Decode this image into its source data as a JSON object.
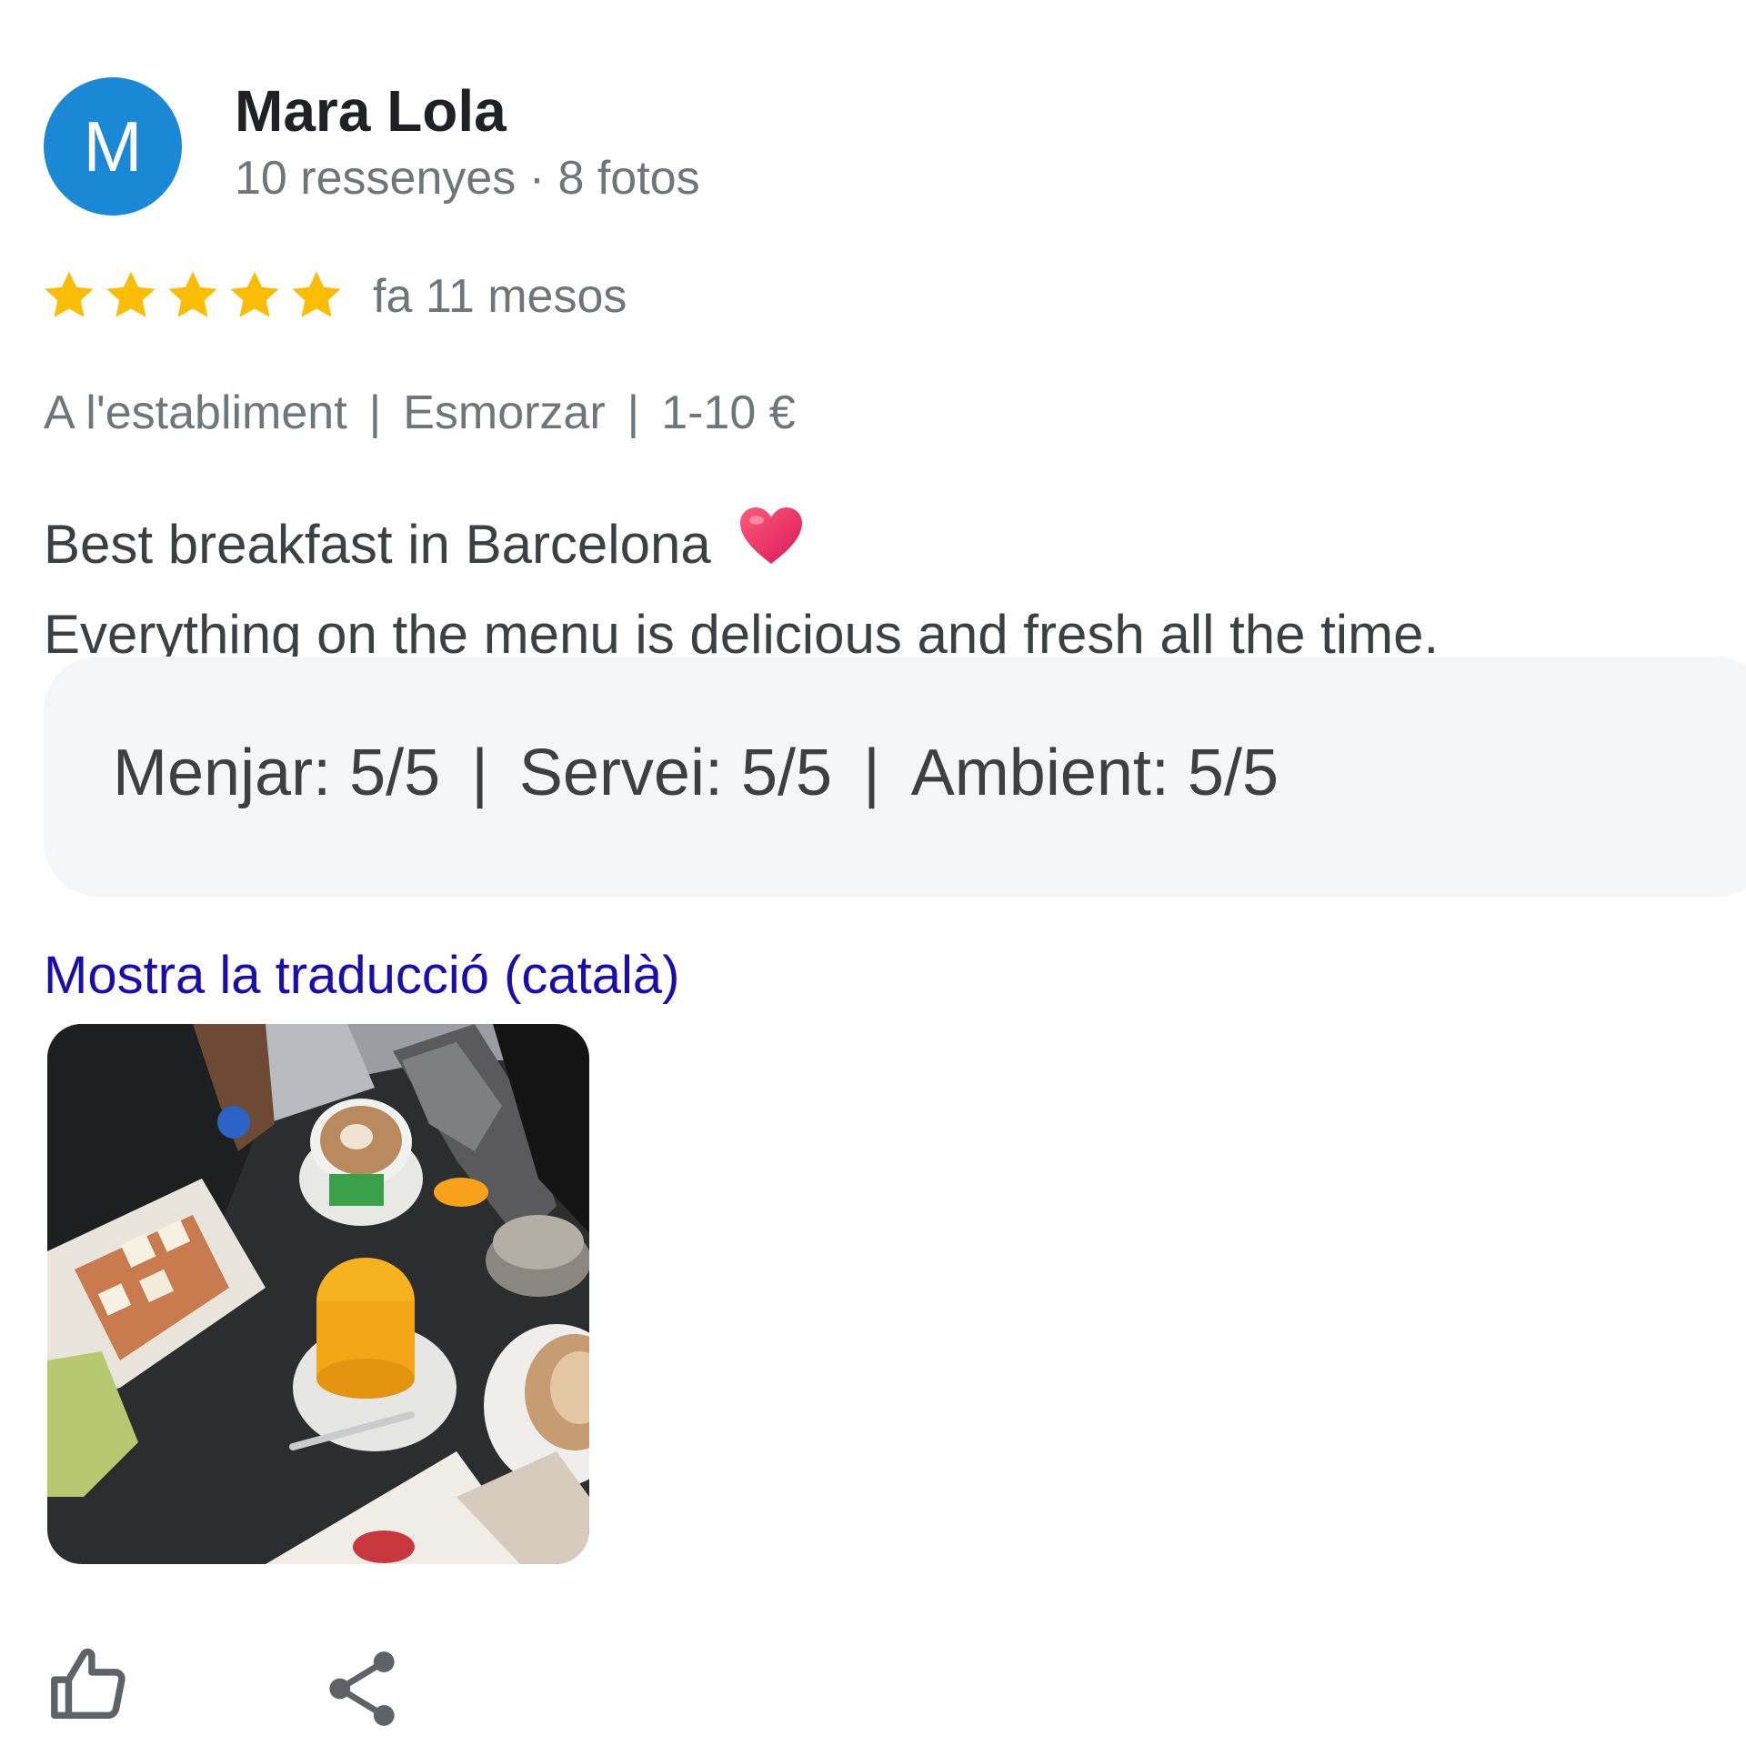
{
  "author": {
    "initial": "M",
    "name": "Mara Lola",
    "meta": "10 ressenyes · 8 fotos",
    "avatar_color": "#1a88d5"
  },
  "rating": {
    "stars": 5,
    "max": 5,
    "star_color": "#fbbc04",
    "date": "fa 11 mesos"
  },
  "tags": [
    "A l'establiment",
    "Esmorzar",
    "1-10 €"
  ],
  "tag_separator": "|",
  "review": {
    "line1": "Best breakfast in Barcelona",
    "line1_emoji": "heart-icon",
    "line2": "Everything on the menu is delicious and fresh all the time."
  },
  "subratings": [
    {
      "text": "Menjar: 5/5"
    },
    {
      "text": "Servei: 5/5"
    },
    {
      "text": "Ambient: 5/5"
    }
  ],
  "subratings_separator": "|",
  "translate_link": "Mostra la traducció (català)",
  "photo": {
    "icon": "breakfast-photo"
  },
  "actions": {
    "like_icon": "thumb-up-icon",
    "share_icon": "share-icon"
  },
  "colors": {
    "link": "#1a0dab",
    "secondary_text": "#70757a",
    "primary_text": "#3c4043",
    "subratings_bg": "#f5f6f8"
  }
}
